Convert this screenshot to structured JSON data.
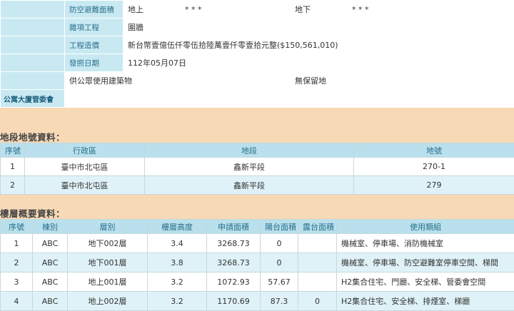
{
  "info": {
    "shelter_label": "防空避難面積",
    "above_label": "地上",
    "above_value": "* * *",
    "below_label": "地下",
    "below_value": "* * *",
    "misc_label": "雜項工程",
    "misc_value": "圍牆",
    "cost_label": "工程造價",
    "cost_value": "新台幣壹億伍仟零伍拾陸萬壹仟零壹拾元整($150,561,010)",
    "issue_label": "發照日期",
    "issue_value": "112年05月07日",
    "public_use": "供公眾使用建築物",
    "no_reserve": "無保留地",
    "committee_label": "公寓大廈管委會",
    "committee_value": ""
  },
  "land": {
    "title": "地段地號資料：",
    "headers": [
      "序號",
      "行政區",
      "地段",
      "地號"
    ],
    "rows": [
      [
        "1",
        "臺中市北屯區",
        "鑫新平段",
        "270-1"
      ],
      [
        "2",
        "臺中市北屯區",
        "鑫新平段",
        "279"
      ]
    ]
  },
  "floors": {
    "title": "樓層概要資料：",
    "headers": [
      "序號",
      "棟別",
      "層別",
      "樓層高度",
      "申請面積",
      "陽台面積",
      "露台面積",
      "使用類組"
    ],
    "rows": [
      [
        "1",
        "ABC",
        "地下002層",
        "3.4",
        "3268.73",
        "0",
        "",
        "機械室、停車場、消防機械室"
      ],
      [
        "2",
        "ABC",
        "地下001層",
        "3.8",
        "3268.73",
        "0",
        "",
        "機械室、停車場、防空避難室停車空間、梯間"
      ],
      [
        "3",
        "ABC",
        "地上001層",
        "3.2",
        "1072.93",
        "57.67",
        "",
        "H2集合住宅、門廳、安全梯、管委會空間"
      ],
      [
        "4",
        "ABC",
        "地上002層",
        "3.2",
        "1170.69",
        "87.3",
        "0",
        "H2集合住宅、安全梯、排煙室、梯廳"
      ]
    ]
  }
}
